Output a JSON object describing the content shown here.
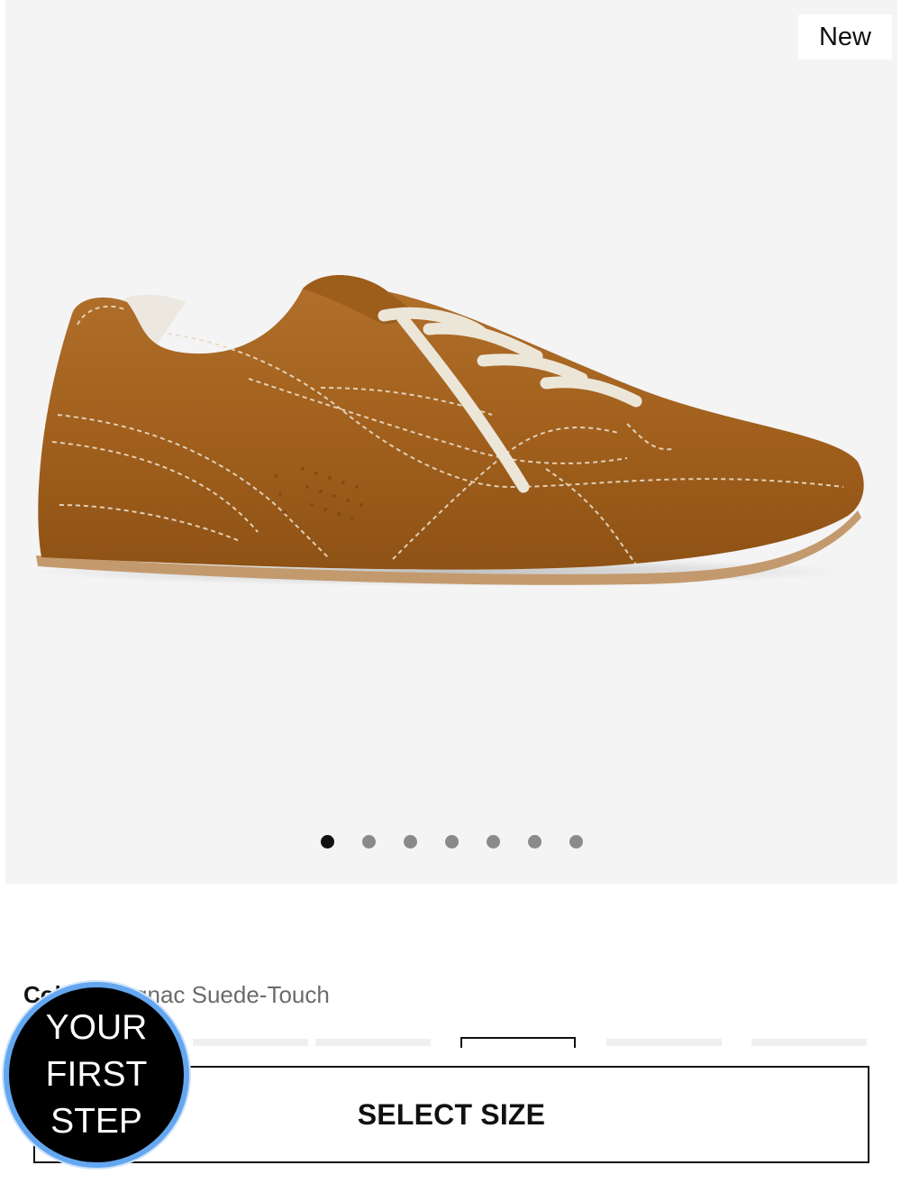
{
  "gallery": {
    "badge": "New",
    "image_alt": "Cognac suede sneaker, side view",
    "slide_count": 7,
    "active_slide": 1
  },
  "product": {
    "color_label": "Color:",
    "color_value": "Cognac Suede-Touch"
  },
  "swatches": {
    "count": 5,
    "selected_index": 2
  },
  "cta": {
    "select_size": "SELECT SIZE"
  },
  "promo": {
    "line1": "YOUR",
    "line2": "FIRST",
    "line3": "STEP"
  },
  "colors": {
    "gallery_bg": "#f4f4f5",
    "suede": "#a3641f",
    "laces": "#ece6d8",
    "promo_ring": "#64a7f0"
  }
}
